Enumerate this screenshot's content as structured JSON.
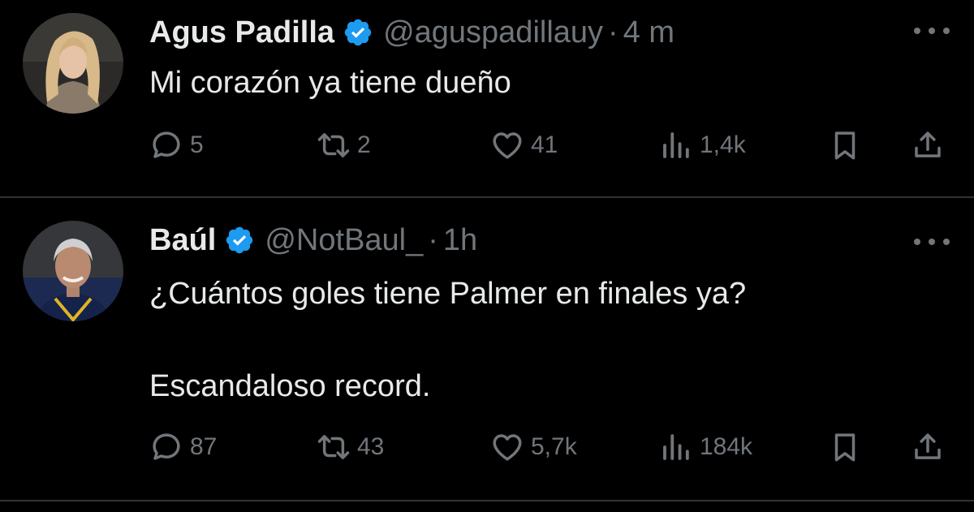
{
  "tweets": [
    {
      "author": {
        "name": "Agus Padilla",
        "handle": "@aguspadillauy",
        "verified": true
      },
      "separator": "·",
      "time": "4 m",
      "text": "Mi corazón ya tiene dueño",
      "stats": {
        "replies": "5",
        "reposts": "2",
        "likes": "41",
        "views": "1,4k"
      }
    },
    {
      "author": {
        "name": "Baúl",
        "handle": "@NotBaul_",
        "verified": true
      },
      "separator": "·",
      "time": "1h",
      "text_lines": [
        "¿Cuántos goles tiene Palmer en finales ya?",
        "Escandaloso record."
      ],
      "stats": {
        "replies": "87",
        "reposts": "43",
        "likes": "5,7k",
        "views": "184k"
      }
    }
  ],
  "icons": {
    "verified": "verified-badge-icon",
    "reply": "reply-icon",
    "repost": "repost-icon",
    "like": "heart-icon",
    "views": "views-icon",
    "bookmark": "bookmark-icon",
    "share": "share-icon",
    "more": "more-icon"
  },
  "colors": {
    "background": "#000000",
    "text": "#e7e9ea",
    "muted": "#71767b",
    "verified": "#1d9bf0",
    "divider": "#2f3336"
  }
}
